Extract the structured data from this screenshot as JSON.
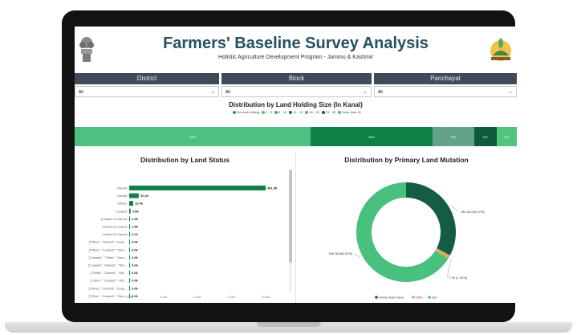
{
  "header": {
    "title": "Farmers' Baseline Survey Analysis",
    "subtitle": "Holistic Agriculture Development Program - Jammu & Kashmir"
  },
  "filters": [
    {
      "label": "District",
      "value": "All"
    },
    {
      "label": "Block",
      "value": "All"
    },
    {
      "label": "Panchayat",
      "value": "All"
    }
  ],
  "land_holding": {
    "title": "Distribution by Land Holding Size (In Kanal)",
    "legend": [
      "No land holding",
      "1 - 5",
      "6 - 10",
      "11 - 15",
      "16 - 20",
      "21 - 40",
      "More than 40"
    ],
    "colors": [
      "#1f9f5e",
      "#4ec47f",
      "#25b36b",
      "#14784a",
      "#6aa58b",
      "#0f5e3f",
      "#44c27a"
    ],
    "segments": [
      {
        "label": "53%",
        "share": 0.534,
        "color": "#4dc082"
      },
      {
        "label": "28%",
        "share": 0.275,
        "color": "#0e7f47"
      },
      {
        "label": "9%",
        "share": 0.095,
        "color": "#63a488"
      },
      {
        "label": "5%",
        "share": 0.05,
        "color": "#105a3d"
      },
      {
        "label": "3%",
        "share": 0.046,
        "color": "#4ec47f"
      }
    ]
  },
  "land_status": {
    "title": "Distribution by Land Status",
    "x_ticks": [
      "0.0M",
      "0.1M",
      "0.2M",
      "0.3M",
      "0.4M"
    ],
    "rows": [
      {
        "label": "Owned",
        "value": 461.88,
        "text": "461.88"
      },
      {
        "label": "Owned",
        "value": 32.28,
        "text": "32.28"
      },
      {
        "label": "Others",
        "value": 13.46,
        "text": "13.46"
      },
      {
        "label": "Leased",
        "value": 4.58,
        "text": "4.58"
      },
      {
        "label": "[Leased & Owned",
        "value": 2.38,
        "text": "2.38"
      },
      {
        "label": "Owned & Leased",
        "value": 1.58,
        "text": "1.58"
      },
      {
        "label": "Leased & Owned",
        "value": 0.24,
        "text": "0.24"
      },
      {
        "label": "[\"Other\", \"Owned\", \"Leas...",
        "value": 0.06,
        "text": "0.06"
      },
      {
        "label": "[\"Other\", \"Leased\", \"Own...",
        "value": 0.06,
        "text": "0.06"
      },
      {
        "label": "[\"Leased\", \"Other\", \"Own...",
        "value": 0.06,
        "text": "0.06"
      },
      {
        "label": "[\"Leased\", \"Owned\", \"Oth...",
        "value": 0.06,
        "text": "0.06"
      },
      {
        "label": "[\"Other\", \"Owned\", \"Oth...",
        "value": 0.06,
        "text": "0.06"
      },
      {
        "label": "[\"Other\", \"Leased\", \"Oth...",
        "value": 0.06,
        "text": "0.06"
      },
      {
        "label": "[\"Other\", \"Owned\", \"Leas...",
        "value": 0.06,
        "text": "0.06"
      },
      {
        "label": "[\"Other\", \"Leased\", \"Own...",
        "value": 0.06,
        "text": "0.06"
      }
    ]
  },
  "primary_mutation": {
    "title": "Distribution by Primary Land Mutation",
    "slices": [
      {
        "name": "Family Head Father",
        "value": 181.48,
        "label": "181.48 (30.27%)",
        "color": "#155c45"
      },
      {
        "name": "Other",
        "value": 7.19,
        "label": "7.19 (1.31%)",
        "color": "#e2a65a"
      },
      {
        "name": "Self",
        "value": 366.38,
        "label": "366.38 (68.42%)",
        "color": "#4ac07e"
      }
    ],
    "legend": [
      "Family Head Father",
      "Other",
      "Self"
    ]
  },
  "chart_data": [
    {
      "type": "bar",
      "title": "Distribution by Land Holding Size (In Kanal)",
      "categories": [
        "No land holding",
        "1 - 5",
        "6 - 10",
        "11 - 15",
        "16 - 20",
        "21 - 40",
        "More than 40"
      ],
      "values": [
        53,
        28,
        9,
        5,
        3
      ],
      "xlabel": "",
      "ylabel": ""
    },
    {
      "type": "bar",
      "title": "Distribution by Land Status",
      "categories": [
        "Owned",
        "Owned",
        "Others",
        "Leased",
        "[Leased & Owned",
        "Owned & Leased",
        "Leased & Owned"
      ],
      "values": [
        461.88,
        32.28,
        13.46,
        4.58,
        2.38,
        1.58,
        0.24
      ],
      "xlabel": "",
      "ylabel": ""
    },
    {
      "type": "pie",
      "title": "Distribution by Primary Land Mutation",
      "categories": [
        "Family Head Father",
        "Other",
        "Self"
      ],
      "values": [
        181.48,
        7.19,
        366.38
      ]
    }
  ]
}
